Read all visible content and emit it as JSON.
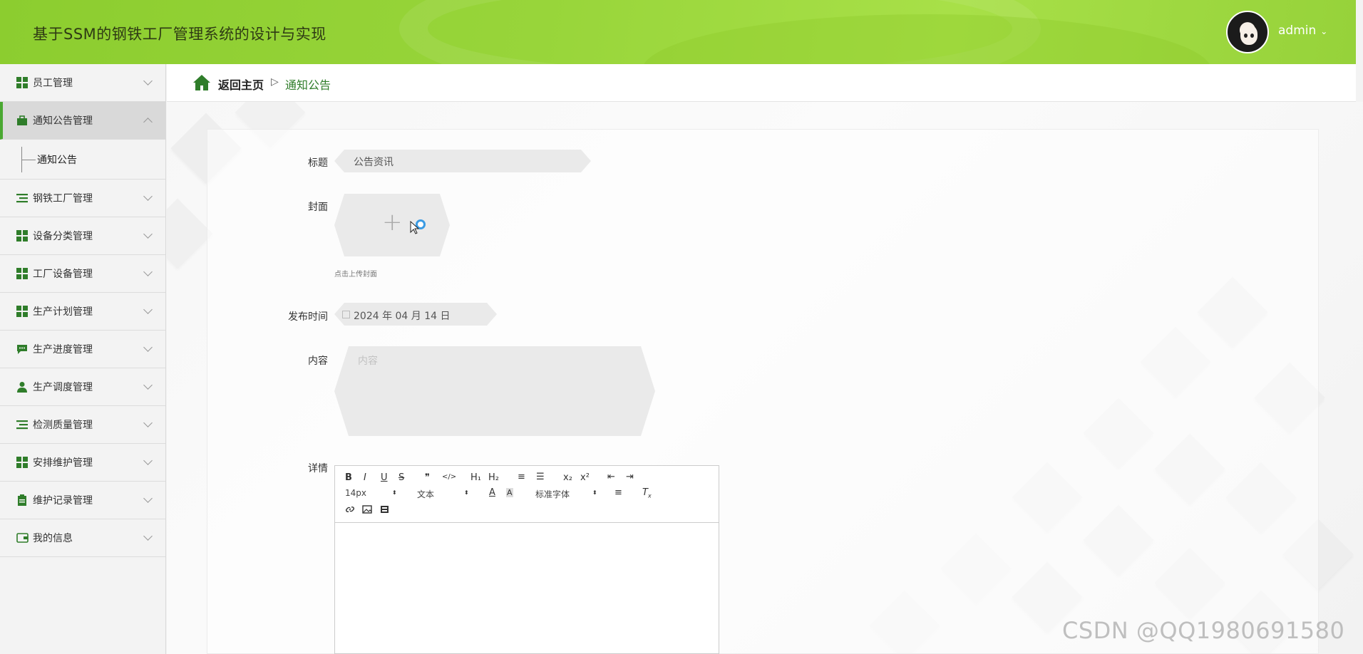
{
  "app": {
    "title": "基于SSM的钢铁工厂管理系统的设计与实现",
    "user": "admin"
  },
  "sidebar": {
    "items": [
      {
        "label": "员工管理",
        "icon": "grid-icon"
      },
      {
        "label": "通知公告管理",
        "icon": "briefcase-icon",
        "expanded": true,
        "sub": [
          "通知公告"
        ]
      },
      {
        "label": "钢铁工厂管理",
        "icon": "list-icon"
      },
      {
        "label": "设备分类管理",
        "icon": "grid-icon"
      },
      {
        "label": "工厂设备管理",
        "icon": "grid-icon"
      },
      {
        "label": "生产计划管理",
        "icon": "grid-icon"
      },
      {
        "label": "生产进度管理",
        "icon": "chat-icon"
      },
      {
        "label": "生产调度管理",
        "icon": "user-icon"
      },
      {
        "label": "检测质量管理",
        "icon": "list-icon"
      },
      {
        "label": "安排维护管理",
        "icon": "grid-icon"
      },
      {
        "label": "维护记录管理",
        "icon": "clipboard-icon"
      },
      {
        "label": "我的信息",
        "icon": "wallet-icon"
      }
    ]
  },
  "breadcrumb": {
    "home": "返回主页",
    "separator": "▷",
    "current": "通知公告"
  },
  "form": {
    "title_label": "标题",
    "title_value": "公告资讯",
    "cover_label": "封面",
    "cover_hint": "点击上传封面",
    "date_label": "发布时间",
    "date_value": "2024 年 04 月 14 日",
    "content_label": "内容",
    "content_placeholder": "内容",
    "detail_label": "详情"
  },
  "editor": {
    "row1": [
      "B",
      "I",
      "U",
      "S",
      "❞",
      "</>",
      "H₁",
      "H₂",
      "≡",
      "☰",
      "x₂",
      "x²",
      "⇤",
      "⇥"
    ],
    "size_value": "14px",
    "header_value": "文本",
    "font_value": "标准字体"
  },
  "watermark": "CSDN @QQ1980691580",
  "colors": {
    "accent": "#2f7d2a",
    "header": "#96d23a",
    "active_border": "#4aa832"
  }
}
